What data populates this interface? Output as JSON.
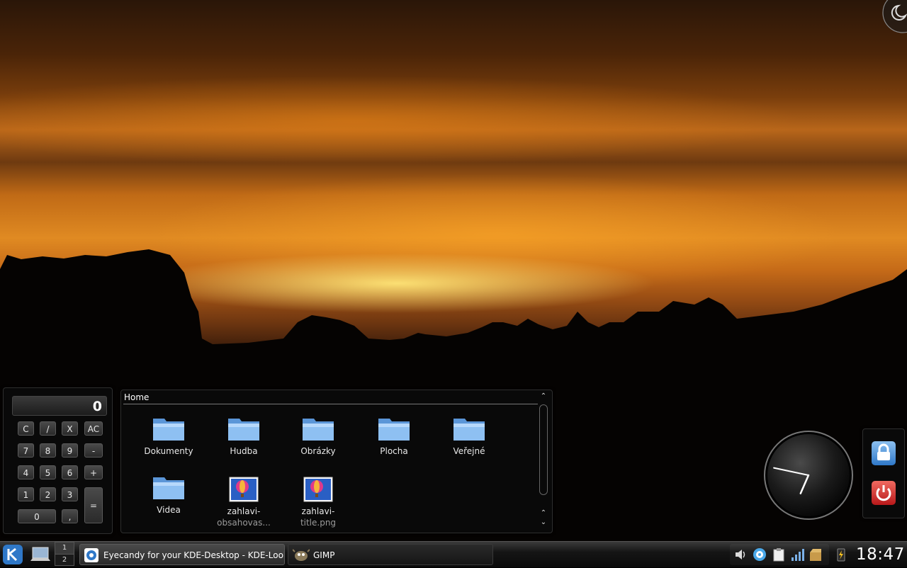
{
  "calculator": {
    "display": "0",
    "keys": [
      "C",
      "/",
      "X",
      "AC",
      "7",
      "8",
      "9",
      "-",
      "4",
      "5",
      "6",
      "+",
      "1",
      "2",
      "3",
      "=",
      "0",
      ","
    ]
  },
  "folderview": {
    "title": "Home",
    "items": [
      {
        "label": "Dokumenty",
        "icon": "folder-icon"
      },
      {
        "label": "Hudba",
        "icon": "folder-icon"
      },
      {
        "label": "Obrázky",
        "icon": "folder-icon"
      },
      {
        "label": "Plocha",
        "icon": "folder-icon"
      },
      {
        "label": "Veřejné",
        "icon": "folder-icon"
      },
      {
        "label": "Videa",
        "icon": "folder-icon"
      },
      {
        "label": "zahlavi-",
        "label2": "obsahovas...",
        "icon": "image-file-icon"
      },
      {
        "label": "zahlavi-",
        "label2": "title.png",
        "icon": "image-file-icon"
      }
    ]
  },
  "pager": {
    "desktops": [
      "1",
      "2"
    ]
  },
  "tasks": [
    {
      "label": "Eyecandy for your KDE-Desktop - KDE-Look",
      "icon": "browser-icon"
    },
    {
      "label": "GIMP",
      "icon": "gimp-icon"
    }
  ],
  "tray": [
    "volume-icon",
    "network-chat-icon",
    "clipboard-icon",
    "signal-icon",
    "package-manager-icon",
    "battery-icon"
  ],
  "clock": {
    "time": "18:47"
  },
  "analog_clock": {
    "hour": 6,
    "minute": 47
  },
  "colors": {
    "panel": "#151515",
    "accent": "#4a90d9",
    "logout": "#c8241e"
  }
}
